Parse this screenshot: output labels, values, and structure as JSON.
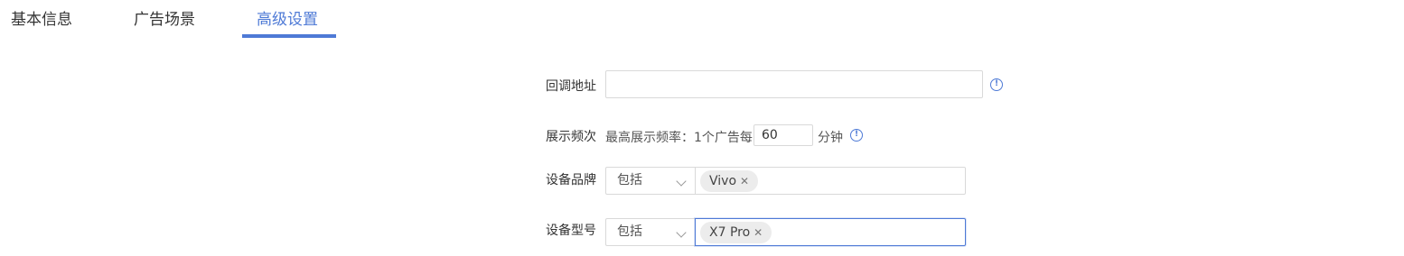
{
  "tabs": [
    {
      "label": "基本信息"
    },
    {
      "label": "广告场景"
    },
    {
      "label": "高级设置"
    }
  ],
  "form": {
    "callback": {
      "label": "回调地址",
      "value": "",
      "info_icon": "info-circle-icon"
    },
    "frequency": {
      "label": "展示频次",
      "prefix": "最高展示频率：1个广告每",
      "value": "60",
      "suffix": "分钟",
      "info_icon": "info-circle-icon"
    },
    "brand": {
      "label": "设备品牌",
      "select_value": "包括",
      "tags": [
        {
          "text": "Vivo"
        }
      ]
    },
    "model": {
      "label": "设备型号",
      "select_value": "包括",
      "tags": [
        {
          "text": "X7 Pro"
        }
      ]
    }
  },
  "colors": {
    "accent": "#4e7ad6",
    "border": "#d9d9d9",
    "tag_bg": "#ececec"
  }
}
